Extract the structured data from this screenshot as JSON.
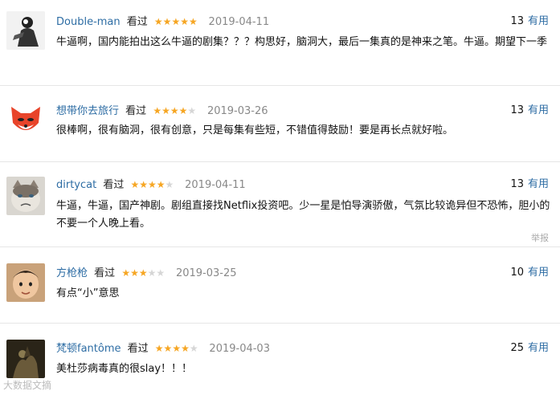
{
  "reviews": [
    {
      "user": "Double-man",
      "status": "看过",
      "rating": 5,
      "date": "2019-04-11",
      "useful_count": "13",
      "useful_label": "有用",
      "text": "牛逼啊，国内能拍出这么牛逼的剧集？？？构思好，脑洞大，最后一集真的是神来之笔。牛逼。期望下一季",
      "avatar": "avatar-bw-photo"
    },
    {
      "user": "想带你去旅行",
      "status": "看过",
      "rating": 4,
      "date": "2019-03-26",
      "useful_count": "13",
      "useful_label": "有用",
      "text": "很棒啊，很有脑洞，很有创意，只是每集有些短，不错值得鼓励！要是再长点就好啦。",
      "avatar": "avatar-red-fox-cartoon"
    },
    {
      "user": "dirtycat",
      "status": "看过",
      "rating": 4,
      "date": "2019-04-11",
      "useful_count": "13",
      "useful_label": "有用",
      "text": "牛逼，牛逼，国产神剧。剧组直接找Netflix投资吧。少一星是怕导演骄傲，气氛比较诡异但不恐怖，胆小的不要一个人晚上看。",
      "report": "举报",
      "avatar": "avatar-grumpy-cat"
    },
    {
      "user": "方枪枪",
      "status": "看过",
      "rating": 3,
      "date": "2019-03-25",
      "useful_count": "10",
      "useful_label": "有用",
      "text": "有点“小”意思",
      "avatar": "avatar-child-photo"
    },
    {
      "user": "梵顿fantôme",
      "status": "看过",
      "rating": 4,
      "date": "2019-04-03",
      "useful_count": "25",
      "useful_label": "有用",
      "text": "美杜莎病毒真的很slay！！！",
      "avatar": "avatar-dark-art"
    }
  ],
  "watermark": "大数据文摘"
}
